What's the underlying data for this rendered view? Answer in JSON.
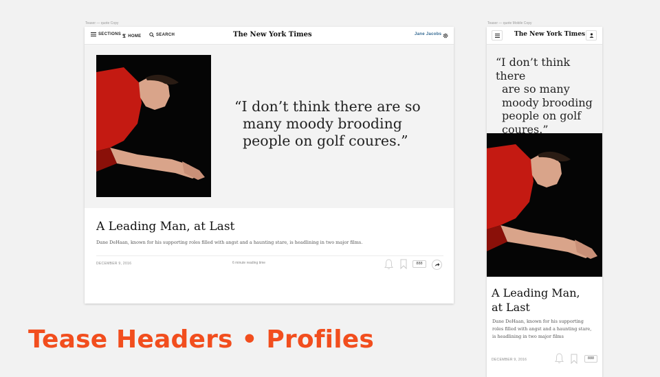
{
  "captions": {
    "desktop": "Teaser — quote Copy",
    "mobile": "Teaser — quote Mobile Copy"
  },
  "desktop": {
    "nav": {
      "sections_label": "SECTIONS",
      "home_label": "HOME",
      "search_label": "SEARCH",
      "user_name": "Jane Jacobs"
    },
    "logo": "The New York Times",
    "quote": [
      "“I don’t think there are so",
      "many moody brooding",
      "people on golf coures.”"
    ],
    "headline": "A Leading Man, at Last",
    "summary": "Dane DeHaan, known for his supporting roles filled with angst and a haunting stare, is headlining in two major films.",
    "date": "DECEMBER 9, 2016",
    "reading_time": "6 minute reading time",
    "comment_count": "888"
  },
  "mobile": {
    "logo": "The New York Times",
    "quote": [
      "“I don’t think there",
      "are so many",
      "moody brooding",
      "people on golf",
      "coures.”"
    ],
    "headline": [
      "A Leading Man,",
      "at Last"
    ],
    "summary": [
      "Dane DeHaan, known for his supporting",
      "roles filled with angst and a haunting stare,",
      "is headlining in two major films"
    ],
    "date": "DECEMBER 9, 2016",
    "comment_count": "888"
  },
  "slide_title": "Tease Headers • Profiles",
  "colors": {
    "title": "#f24e1e",
    "user_link": "#326891",
    "photo_bg": "#050505",
    "shirt": "#c41a12"
  },
  "icons": [
    "menu-icon",
    "nyt-t-icon",
    "search-icon",
    "gear-icon",
    "user-icon",
    "bell-icon",
    "bookmark-icon",
    "share-icon"
  ]
}
